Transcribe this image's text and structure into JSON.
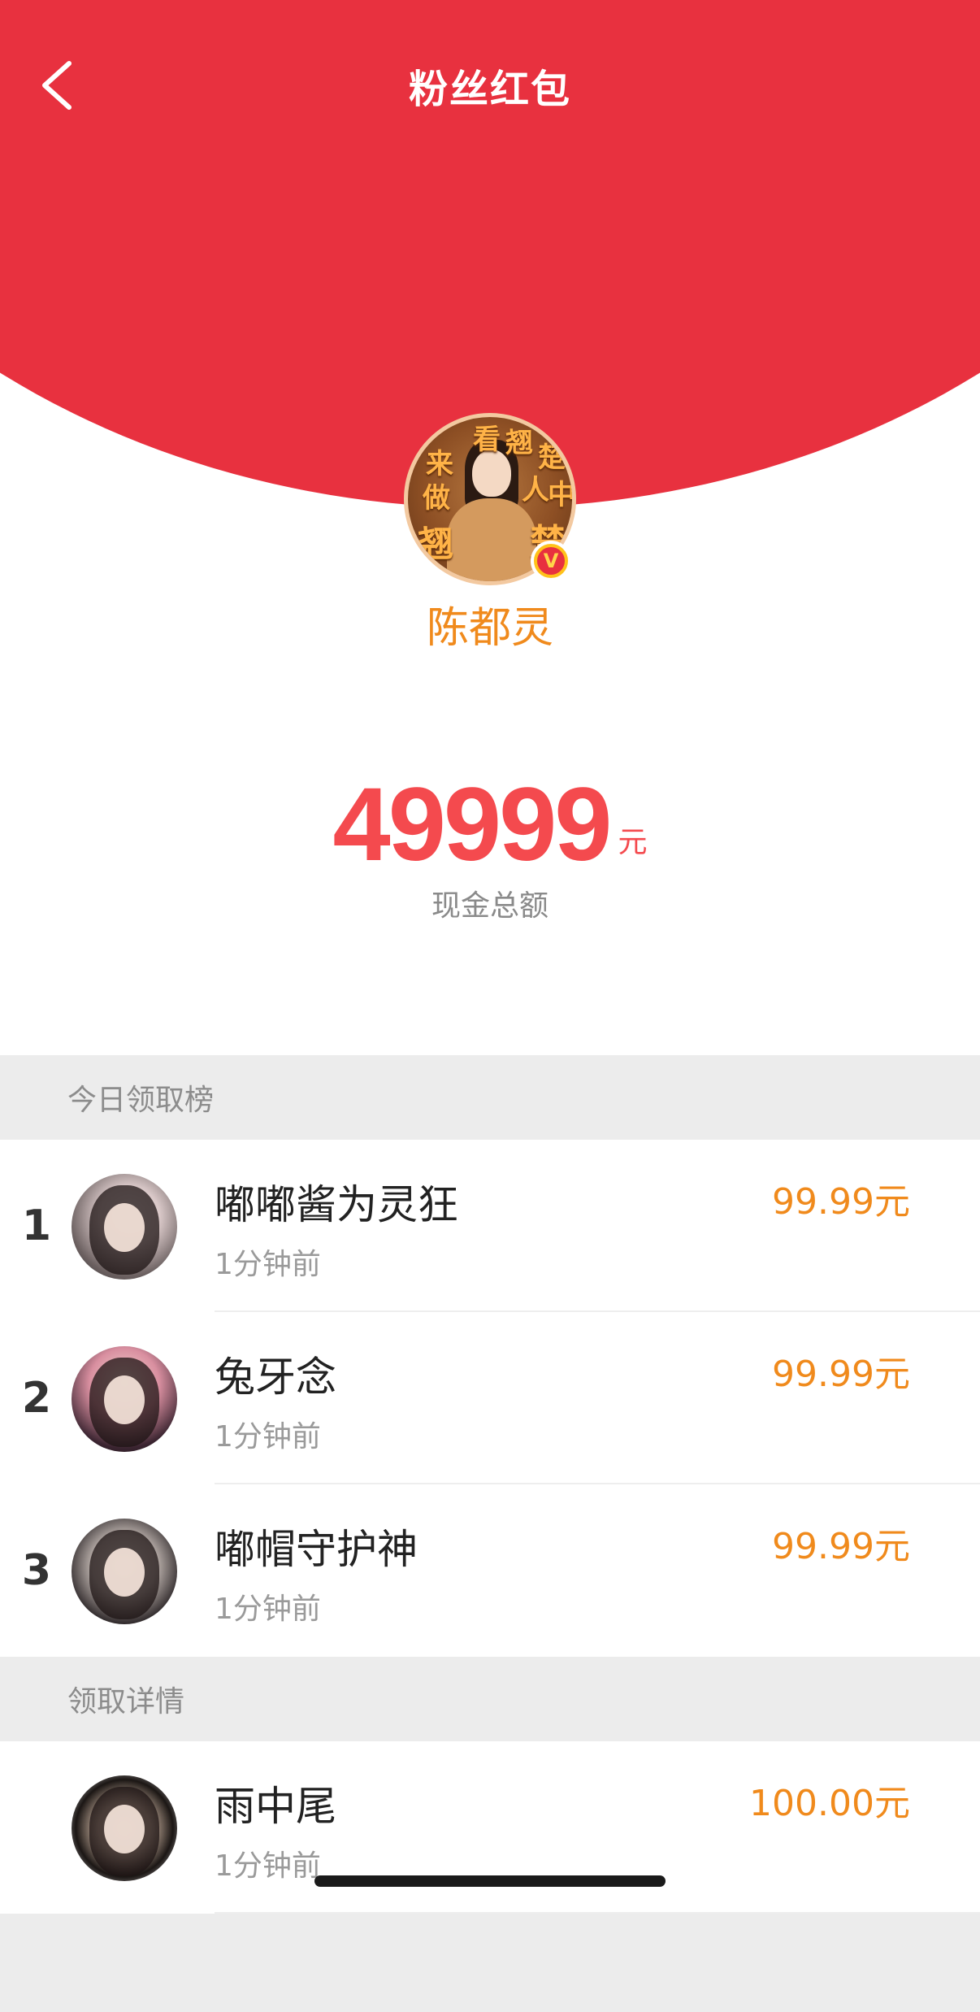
{
  "nav": {
    "title": "粉丝红包"
  },
  "host": {
    "name": "陈都灵",
    "avatar_text": [
      "来",
      "看",
      "翘",
      "楚",
      "做",
      "人",
      "中",
      "翘",
      "楚"
    ],
    "verified_mark": "V"
  },
  "total": {
    "amount": "49999",
    "unit": "元",
    "label": "现金总额"
  },
  "today_rank": {
    "header": "今日领取榜",
    "rows": [
      {
        "rank": "1",
        "name": "嘟嘟酱为灵狂",
        "time": "1分钟前",
        "amount": "99.99元"
      },
      {
        "rank": "2",
        "name": "兔牙念",
        "time": "1分钟前",
        "amount": "99.99元"
      },
      {
        "rank": "3",
        "name": "嘟帽守护神",
        "time": "1分钟前",
        "amount": "99.99元"
      }
    ]
  },
  "details": {
    "header": "领取详情",
    "rows": [
      {
        "name": "雨中尾",
        "time": "1分钟前",
        "amount": "100.00元"
      }
    ]
  },
  "colors": {
    "header_red": "#e8313f",
    "accent_orange": "#f08a1c",
    "total_red": "#f44a4e",
    "cream_rim": "#fde5c3"
  },
  "icons": {
    "back": "chevron-left-icon",
    "verified": "verified-badge-icon"
  }
}
